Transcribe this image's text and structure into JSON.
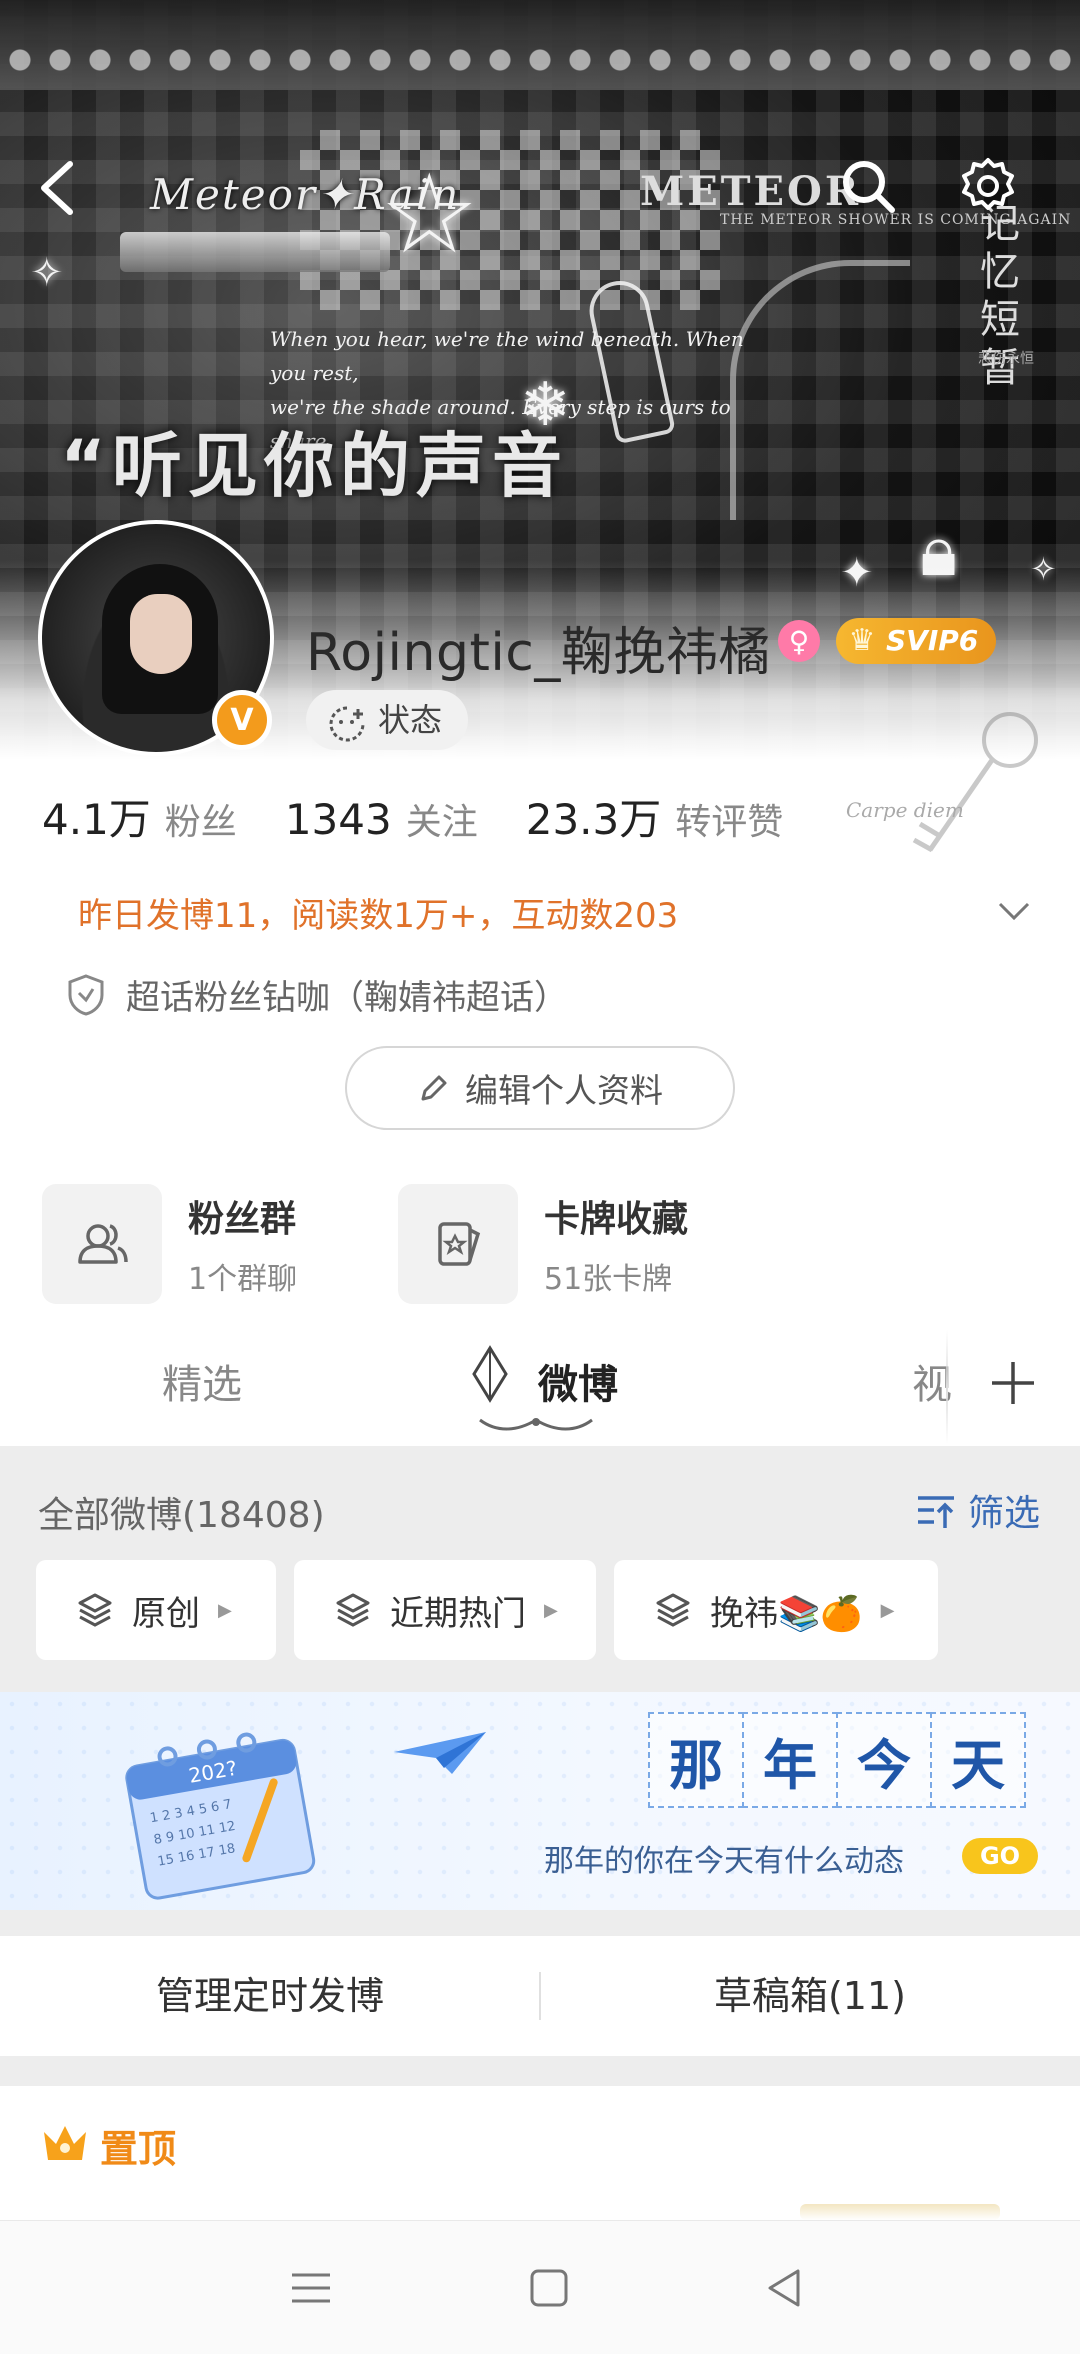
{
  "banner": {
    "script_title": "Meteor✦Rain",
    "meteor_title": "METEOR",
    "meteor_sub": "THE METEOR SHOWER IS COMING AGAIN",
    "quote_line1": "When you hear, we're the wind beneath. When you rest,",
    "quote_line2": "we're the shade around. Every step is ours to share.",
    "cn_title": "“听见你的声音",
    "vertical_text": "记忆短暂",
    "vertical_small": "悲伤永恒"
  },
  "profile": {
    "username": "Rojingtic_鞠挽祎橘",
    "svip_label": "SVIP6",
    "verified_mark": "V",
    "status_label": "状态"
  },
  "stats": [
    {
      "num": "4.1万",
      "label": "粉丝"
    },
    {
      "num": "1343",
      "label": "关注"
    },
    {
      "num": "23.3万",
      "label": "转评赞"
    }
  ],
  "decor": {
    "carpe": "Carpe diem"
  },
  "summary": "昨日发博11，阅读数1万+，互动数203",
  "chaohua": "超话粉丝钻咖（鞠婧祎超话）",
  "edit_profile": "编辑个人资料",
  "features": [
    {
      "title": "粉丝群",
      "sub": "1个群聊"
    },
    {
      "title": "卡牌收藏",
      "sub": "51张卡牌"
    }
  ],
  "tabs": {
    "items": [
      "精选",
      "微博",
      "视"
    ],
    "active": "微博"
  },
  "weibo_list": {
    "all_label": "全部微博(18408)",
    "filter_label": "筛选",
    "chips": [
      "原创",
      "近期热门",
      "挽祎📚🍊"
    ]
  },
  "memory": {
    "chars": [
      "那",
      "年",
      "今",
      "天"
    ],
    "subtitle": "那年的你在今天有什么动态",
    "go": "GO",
    "calendar_year": "202?"
  },
  "manage": {
    "scheduled": "管理定时发博",
    "drafts": "草稿箱(11)"
  },
  "pinned": {
    "label": "置顶"
  },
  "colors": {
    "accent_orange": "#e0722a",
    "link_blue": "#3a6bb5",
    "memory_blue": "#1f56a8",
    "pinned_orange": "#f08a17"
  },
  "icons": {
    "nav": [
      "back-icon",
      "search-icon",
      "settings-icon"
    ],
    "bottom_nav": [
      "menu-icon",
      "home-icon",
      "back-triangle-icon"
    ]
  }
}
